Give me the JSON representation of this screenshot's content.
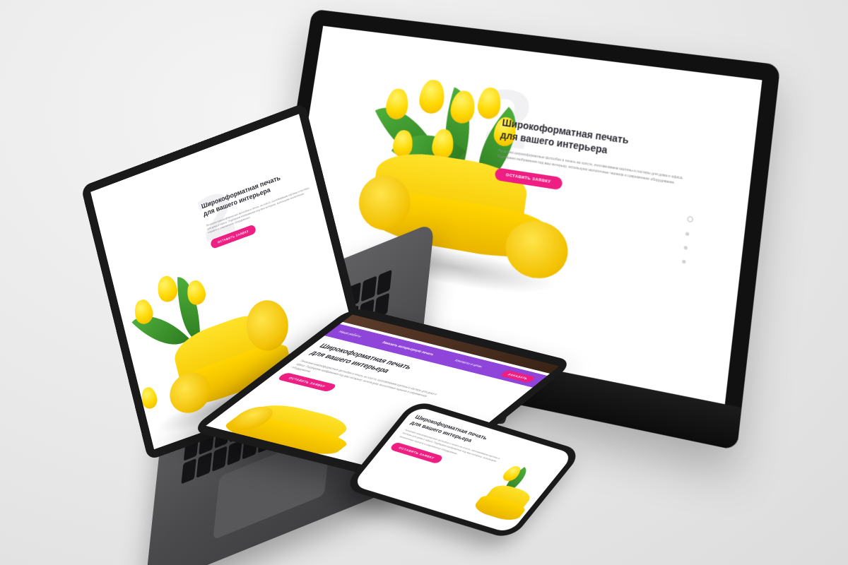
{
  "hero": {
    "title_line1": "Широкоформатная печать",
    "title_line2": "для вашего интерьера",
    "description": "Печатаем широкоформатные фотообои и печать на холсте, изготавливаем картины и постеры для дома и офиса. Подбираем изображения под ваш интерьер, используем экологичные чернила и современное оборудование.",
    "cta_label": "Оставить заявку"
  },
  "tablet_nav": {
    "item1": "Наши работы",
    "item2": "Заказать интерьерную печать",
    "item3": "Контакты и цены",
    "order_label": "Заказать"
  },
  "colors": {
    "accent": "#ee1e82",
    "nav_purple": "#8f45d9",
    "sofa_yellow": "#ffd500"
  }
}
